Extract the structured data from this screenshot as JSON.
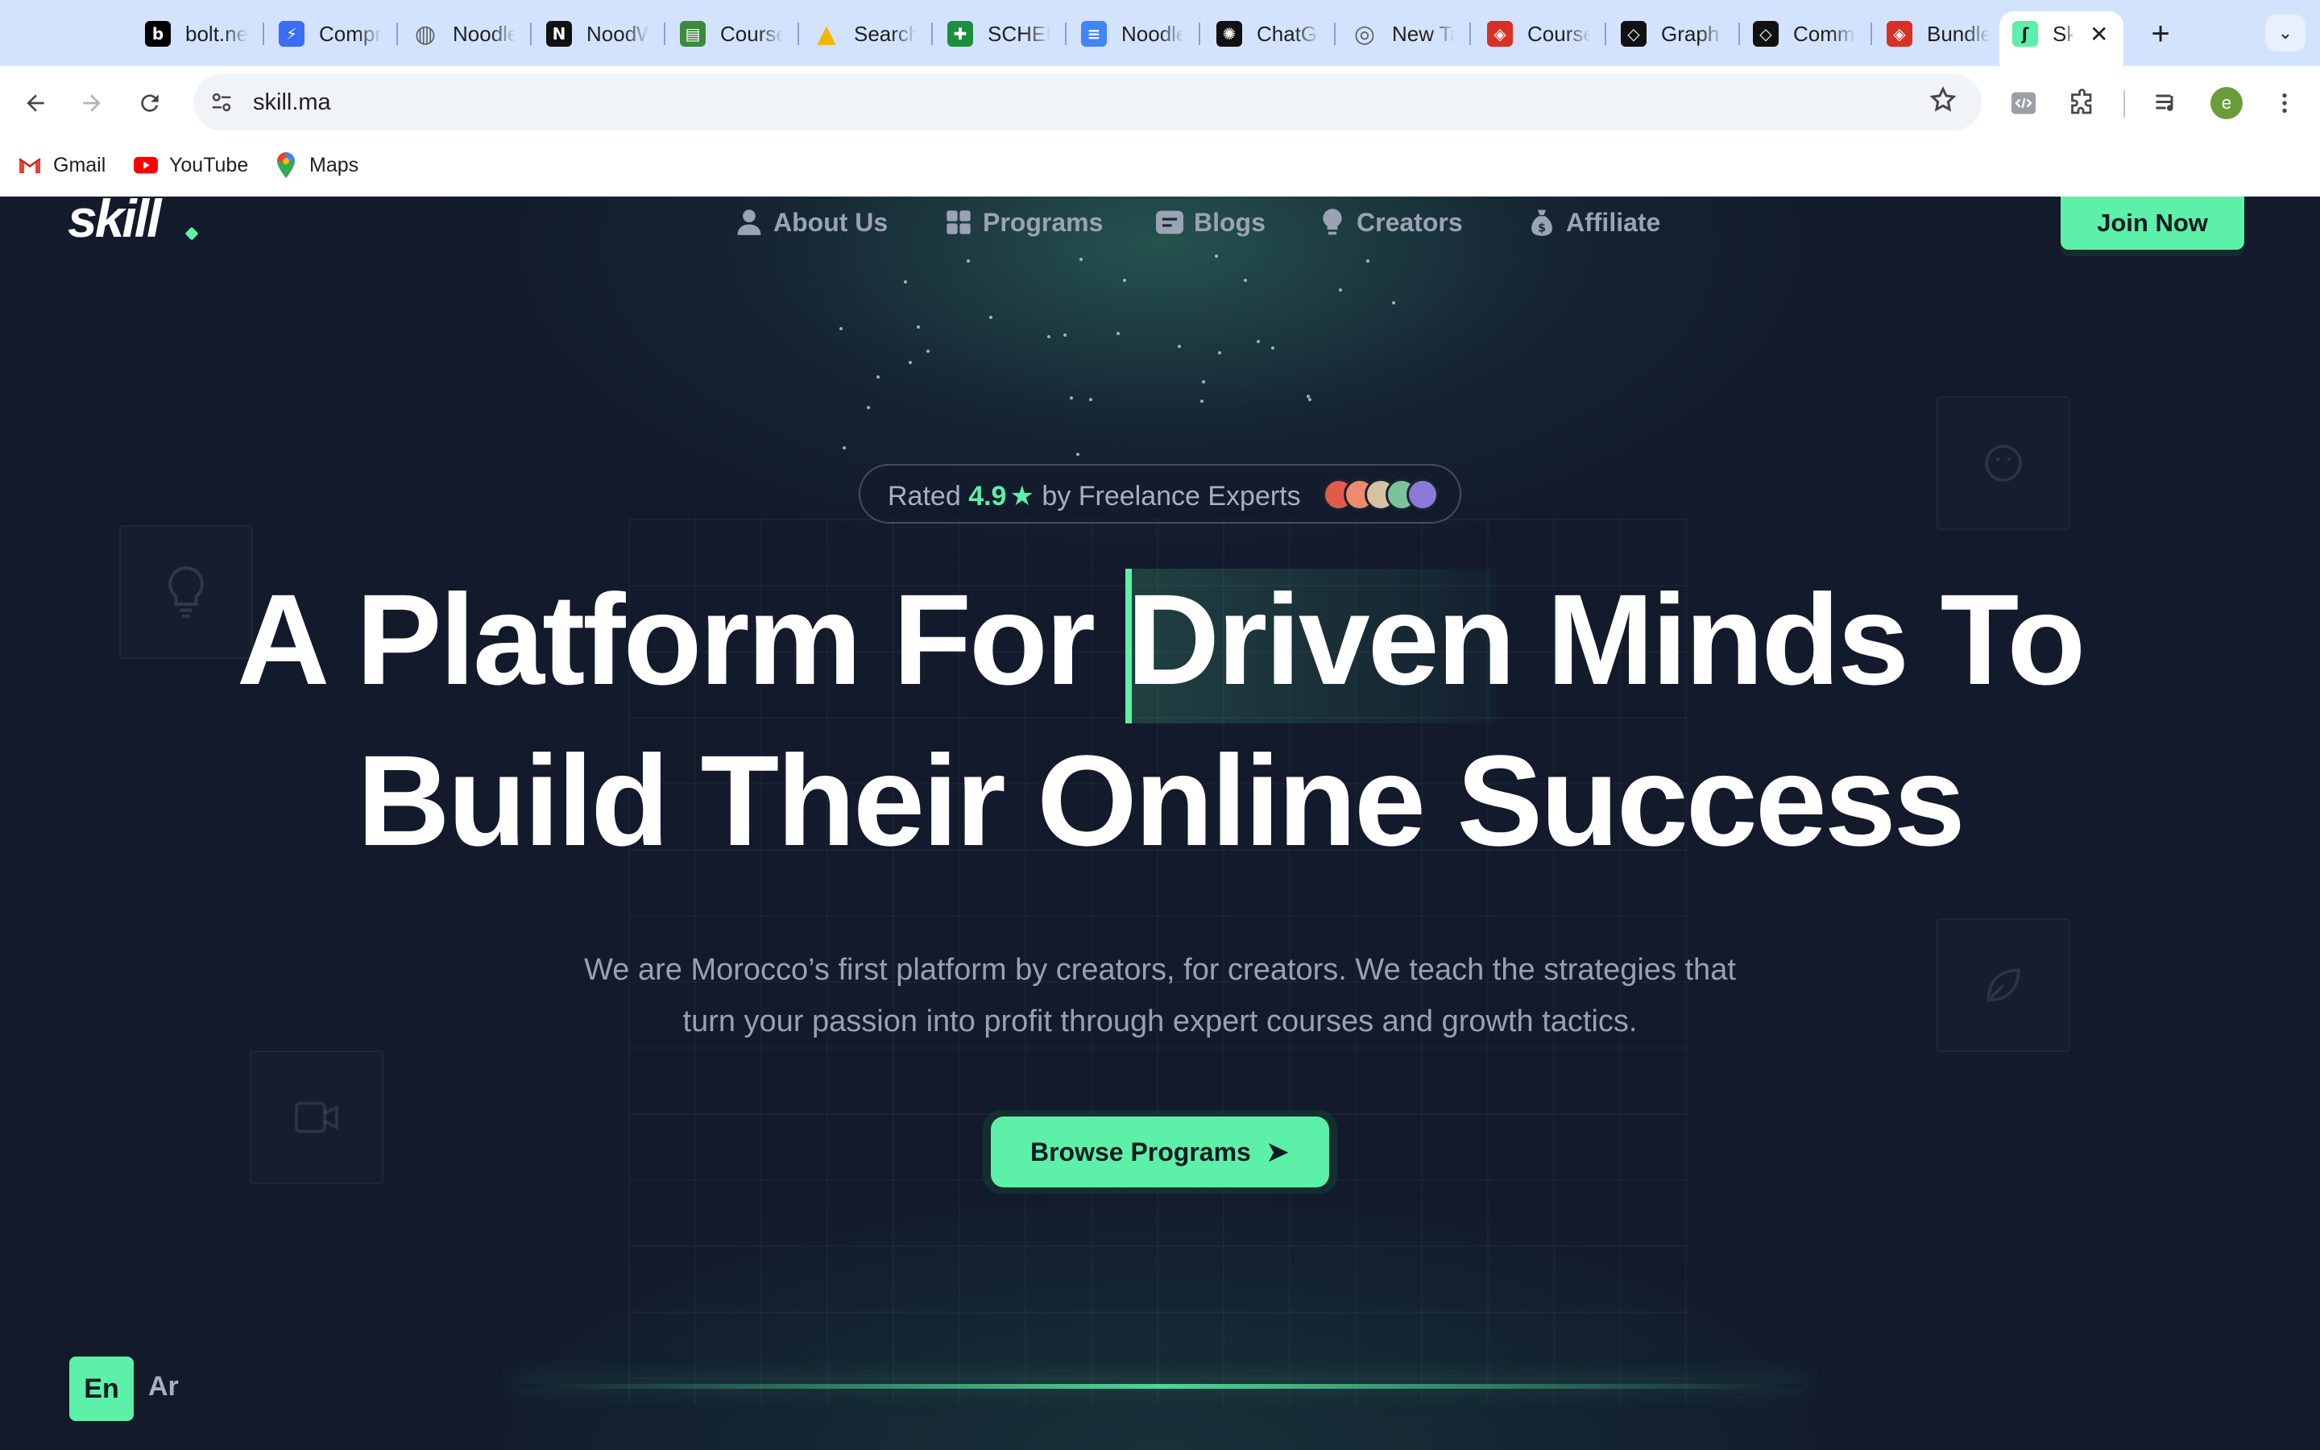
{
  "browser": {
    "tabs": [
      {
        "title": "bolt.new",
        "icon": "bolt-icon",
        "color": "#000000"
      },
      {
        "title": "Compr",
        "icon": "lightning-icon",
        "color": "#3b6cf4"
      },
      {
        "title": "Noodle",
        "icon": "globe-icon",
        "color": "#5f6368"
      },
      {
        "title": "NoodWiki",
        "icon": "notion-icon",
        "color": "#111111"
      },
      {
        "title": "Course",
        "icon": "book-icon",
        "color": "#3b8a3e"
      },
      {
        "title": "Search",
        "icon": "drive-icon",
        "color": "#f4b400"
      },
      {
        "title": "SCHEDULE",
        "icon": "sheets-icon",
        "color": "#1e8e3e"
      },
      {
        "title": "Noodle",
        "icon": "docs-icon",
        "color": "#4285f4"
      },
      {
        "title": "ChatGPT",
        "icon": "openai-icon",
        "color": "#111111"
      },
      {
        "title": "New Tab",
        "icon": "chrome-icon",
        "color": "#5f6368"
      },
      {
        "title": "Course",
        "icon": "diamond-badge-icon",
        "color": "#d93025"
      },
      {
        "title": "Graph",
        "icon": "diamond-icon",
        "color": "#111111"
      },
      {
        "title": "Comm",
        "icon": "diamond-icon",
        "color": "#111111"
      },
      {
        "title": "Bundle",
        "icon": "diamond-badge-icon",
        "color": "#d93025"
      },
      {
        "title": "Skill",
        "icon": "skill-icon",
        "color": "#5cf0a8",
        "active": true
      }
    ],
    "new_tab": "+",
    "tab_menu": "⌄",
    "url": "skill.ma",
    "profile_initial": "e",
    "bookmarks": [
      {
        "label": "Gmail",
        "icon": "gmail-icon"
      },
      {
        "label": "YouTube",
        "icon": "youtube-icon"
      },
      {
        "label": "Maps",
        "icon": "maps-icon"
      }
    ]
  },
  "site": {
    "logo": "skill",
    "nav": [
      {
        "label": "About Us",
        "icon": "user-icon"
      },
      {
        "label": "Programs",
        "icon": "grid-icon"
      },
      {
        "label": "Blogs",
        "icon": "blog-icon"
      },
      {
        "label": "Creators",
        "icon": "bulb-icon"
      },
      {
        "label": "Affiliate",
        "icon": "money-bag-icon"
      }
    ],
    "join_label": "Join Now",
    "rating": {
      "prefix": "Rated",
      "score": "4.9",
      "star": "★",
      "suffix": "by Freelance Experts"
    },
    "headline": {
      "part1": "A Platform For ",
      "highlight": "Driven",
      "part2": " Minds To",
      "line2": "Build Their Online Success"
    },
    "subtitle": {
      "line1": "We are Morocco’s first platform by creators, for creators. We teach the strategies that",
      "line2": "turn your passion into profit through expert courses and growth tactics."
    },
    "cta_label": "Browse Programs",
    "cta_arrow": "➤",
    "lang": {
      "en": "En",
      "ar": "Ar"
    },
    "colors": {
      "accent": "#5cf0a8",
      "background": "#121a2b",
      "muted_text": "#9aa1ae"
    }
  }
}
